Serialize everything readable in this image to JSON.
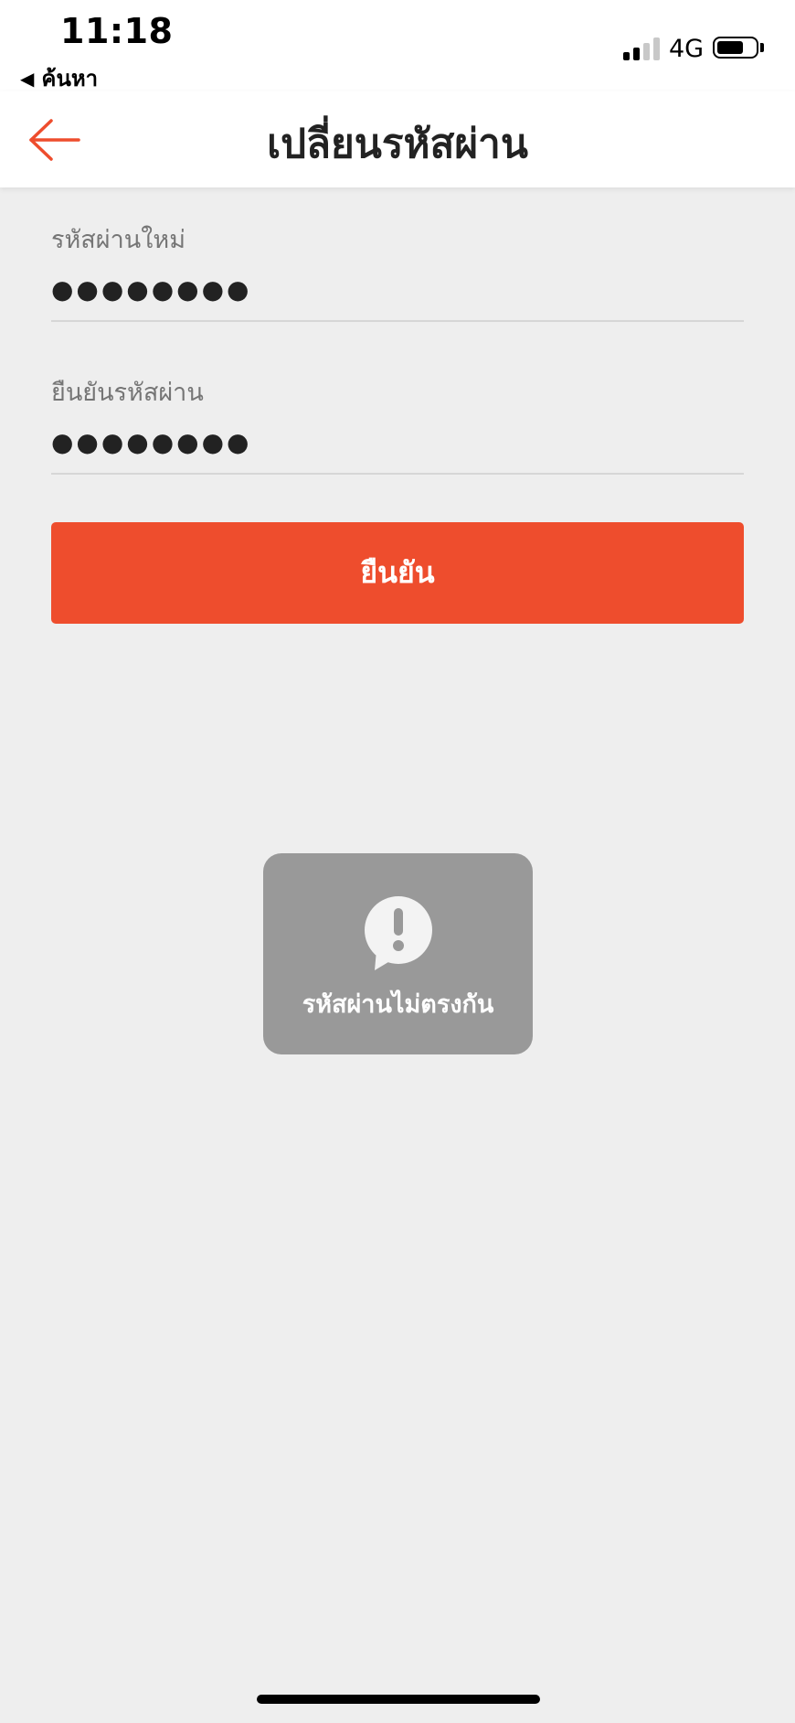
{
  "status_bar": {
    "time": "11:18",
    "back_app_label": "ค้นหา",
    "network": "4G",
    "signal_bars_active": 2,
    "signal_bars_total": 4,
    "battery_level": 0.7
  },
  "header": {
    "title": "เปลี่ยนรหัสผ่าน",
    "back_icon": "arrow-left-icon",
    "accent_color": "#ee4d2d"
  },
  "form": {
    "new_password": {
      "label": "รหัสผ่านใหม่",
      "value": "●●●●●●●●"
    },
    "confirm_password": {
      "label": "ยืนยันรหัสผ่าน",
      "value": "●●●●●●●●"
    },
    "submit_label": "ยืนยัน"
  },
  "toast": {
    "icon": "exclamation-bubble-icon",
    "message": "รหัสผ่านไม่ตรงกัน"
  }
}
